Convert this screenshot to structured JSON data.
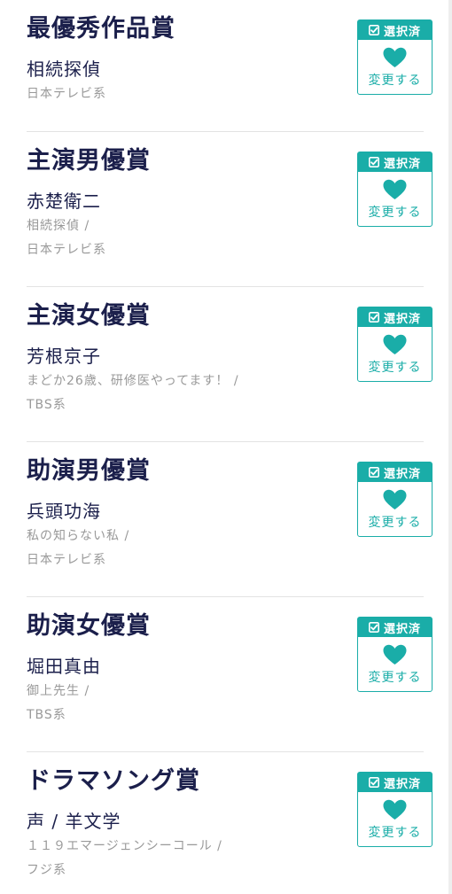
{
  "colors": {
    "accent": "#1aada8",
    "title": "#1b1f4b",
    "meta": "#999999",
    "divider": "#e3e3e3"
  },
  "vote_box": {
    "selected_label": "選択済",
    "change_label": "変更する",
    "icons": [
      "check-square-icon",
      "heart-icon"
    ]
  },
  "awards": [
    {
      "category": "最優秀作品賞",
      "nominee": "相続探偵",
      "meta_lines": [
        "日本テレビ系"
      ]
    },
    {
      "category": "主演男優賞",
      "nominee": "赤楚衛二",
      "meta_lines": [
        "相続探偵 /",
        "日本テレビ系"
      ]
    },
    {
      "category": "主演女優賞",
      "nominee": "芳根京子",
      "meta_lines": [
        "まどか26歳、研修医やってます！ /",
        "TBS系"
      ]
    },
    {
      "category": "助演男優賞",
      "nominee": "兵頭功海",
      "meta_lines": [
        "私の知らない私 /",
        "日本テレビ系"
      ]
    },
    {
      "category": "助演女優賞",
      "nominee": "堀田真由",
      "meta_lines": [
        "御上先生 /",
        "TBS系"
      ]
    },
    {
      "category": "ドラマソング賞",
      "nominee": "声 / 羊文学",
      "meta_lines": [
        "１１９エマージェンシーコール /",
        "フジ系"
      ]
    }
  ]
}
